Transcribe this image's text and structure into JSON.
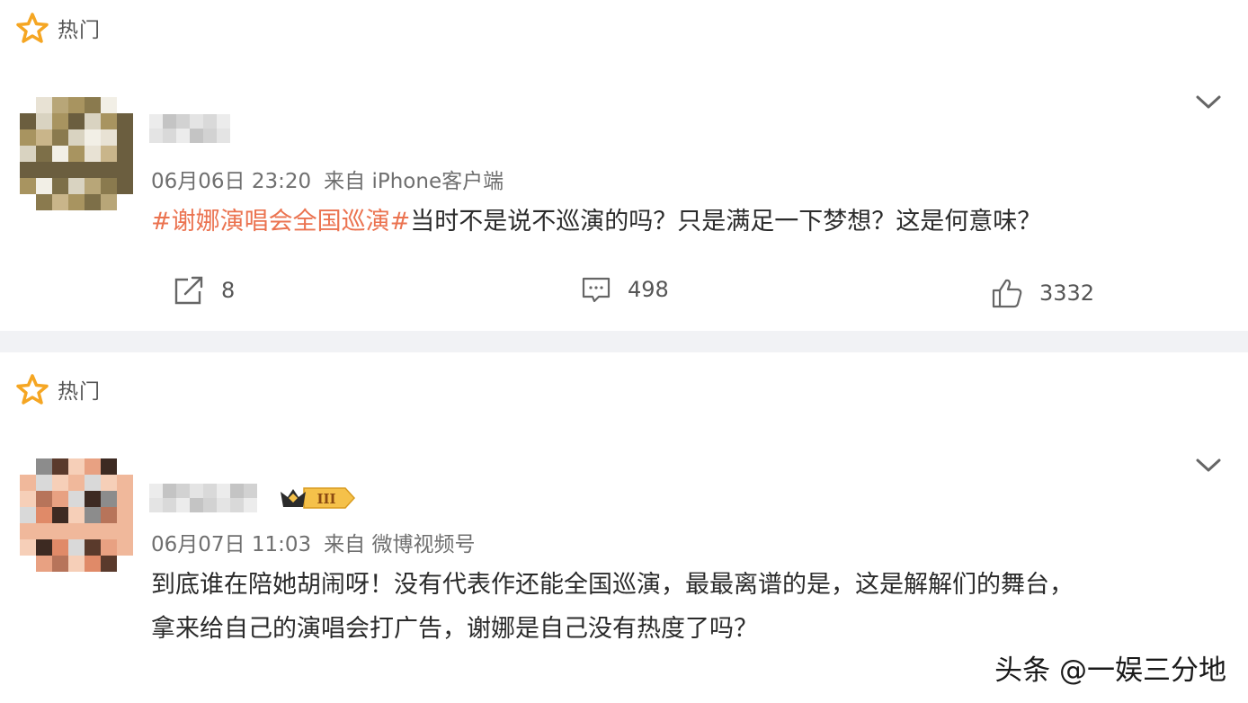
{
  "posts": [
    {
      "hot_label": "热门",
      "date": "06月06日 23:20",
      "source": "来自 iPhone客户端",
      "topic": "#谢娜演唱会全国巡演#",
      "text": "当时不是说不巡演的吗？只是满足一下梦想？这是何意味？",
      "reposts": "8",
      "comments": "498",
      "likes": "3332"
    },
    {
      "hot_label": "热门",
      "date": "06月07日 11:03",
      "source": "来自 微博视频号",
      "badge_text": "III",
      "lines": [
        "到底谁在陪她胡闹呀！没有代表作还能全国巡演，最最离谱的是，这是解解们的舞台，",
        "拿来给自己的演唱会打广告，谢娜是自己没有热度了吗？"
      ]
    }
  ],
  "watermark": "头条 @一娱三分地",
  "colors": {
    "topic": "#eb7350",
    "star": "#f5a623",
    "page_bg": "#f1f2f5"
  }
}
